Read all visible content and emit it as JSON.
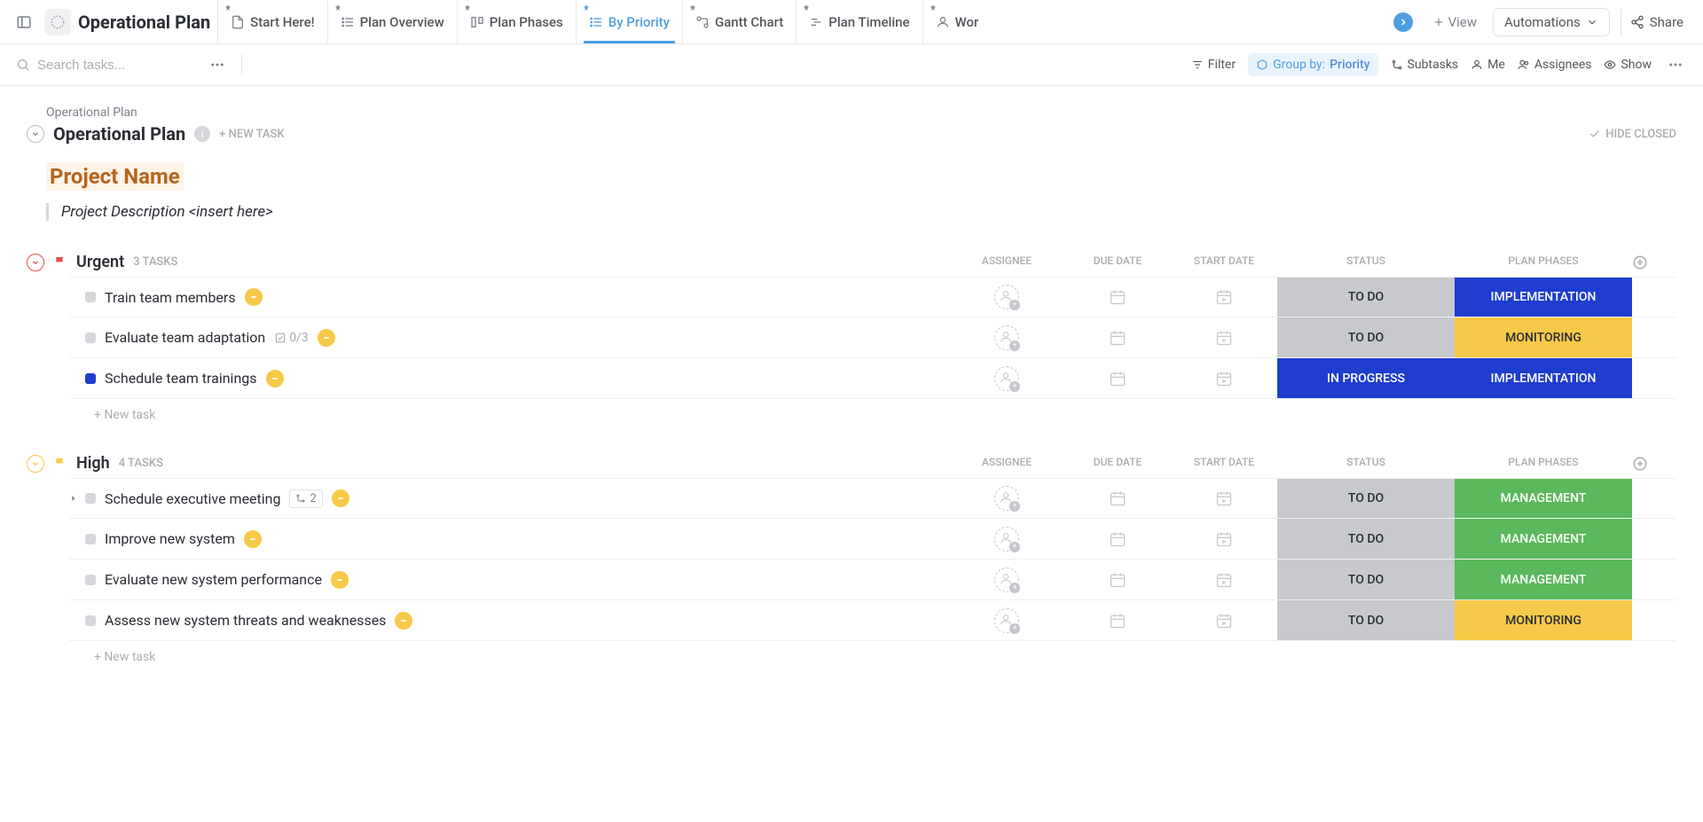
{
  "app": {
    "title": "Operational Plan",
    "tabs": [
      {
        "label": "Start Here!"
      },
      {
        "label": "Plan Overview"
      },
      {
        "label": "Plan Phases"
      },
      {
        "label": "By Priority"
      },
      {
        "label": "Gantt Chart"
      },
      {
        "label": "Plan Timeline"
      },
      {
        "label": "Wor"
      }
    ],
    "view_btn": "View",
    "automations_btn": "Automations",
    "share_btn": "Share"
  },
  "toolbar": {
    "search_placeholder": "Search tasks...",
    "filter": "Filter",
    "group_by_label": "Group by:",
    "group_by_value": "Priority",
    "subtasks": "Subtasks",
    "me": "Me",
    "assignees": "Assignees",
    "show": "Show"
  },
  "page": {
    "breadcrumb": "Operational Plan",
    "title": "Operational Plan",
    "new_task": "+ NEW TASK",
    "hide_closed": "HIDE CLOSED",
    "project_name": "Project Name",
    "project_desc": "Project Description <insert here>"
  },
  "columns": {
    "assignee": "ASSIGNEE",
    "due": "DUE DATE",
    "start": "START DATE",
    "status": "STATUS",
    "phase": "PLAN PHASES"
  },
  "groups": [
    {
      "name": "Urgent",
      "count": "3 TASKS",
      "priority": "urgent",
      "tasks": [
        {
          "name": "Train team members",
          "status": "TO DO",
          "status_class": "status-todo",
          "phase": "IMPLEMENTATION",
          "phase_class": "phase-impl",
          "sq": ""
        },
        {
          "name": "Evaluate team adaptation",
          "status": "TO DO",
          "status_class": "status-todo",
          "phase": "MONITORING",
          "phase_class": "phase-mon",
          "sq": "",
          "checklist": "0/3"
        },
        {
          "name": "Schedule team trainings",
          "status": "IN PROGRESS",
          "status_class": "status-inprogress",
          "phase": "IMPLEMENTATION",
          "phase_class": "phase-impl",
          "sq": "inprogress"
        }
      ],
      "new_task": "+ New task"
    },
    {
      "name": "High",
      "count": "4 TASKS",
      "priority": "high",
      "tasks": [
        {
          "name": "Schedule executive meeting",
          "status": "TO DO",
          "status_class": "status-todo",
          "phase": "MANAGEMENT",
          "phase_class": "phase-mgmt",
          "sq": "",
          "subtasks": "2",
          "expandable": true
        },
        {
          "name": "Improve new system",
          "status": "TO DO",
          "status_class": "status-todo",
          "phase": "MANAGEMENT",
          "phase_class": "phase-mgmt",
          "sq": ""
        },
        {
          "name": "Evaluate new system performance",
          "status": "TO DO",
          "status_class": "status-todo",
          "phase": "MANAGEMENT",
          "phase_class": "phase-mgmt",
          "sq": ""
        },
        {
          "name": "Assess new system threats and weaknesses",
          "status": "TO DO",
          "status_class": "status-todo",
          "phase": "MONITORING",
          "phase_class": "phase-mon",
          "sq": ""
        }
      ],
      "new_task": "+ New task"
    }
  ]
}
